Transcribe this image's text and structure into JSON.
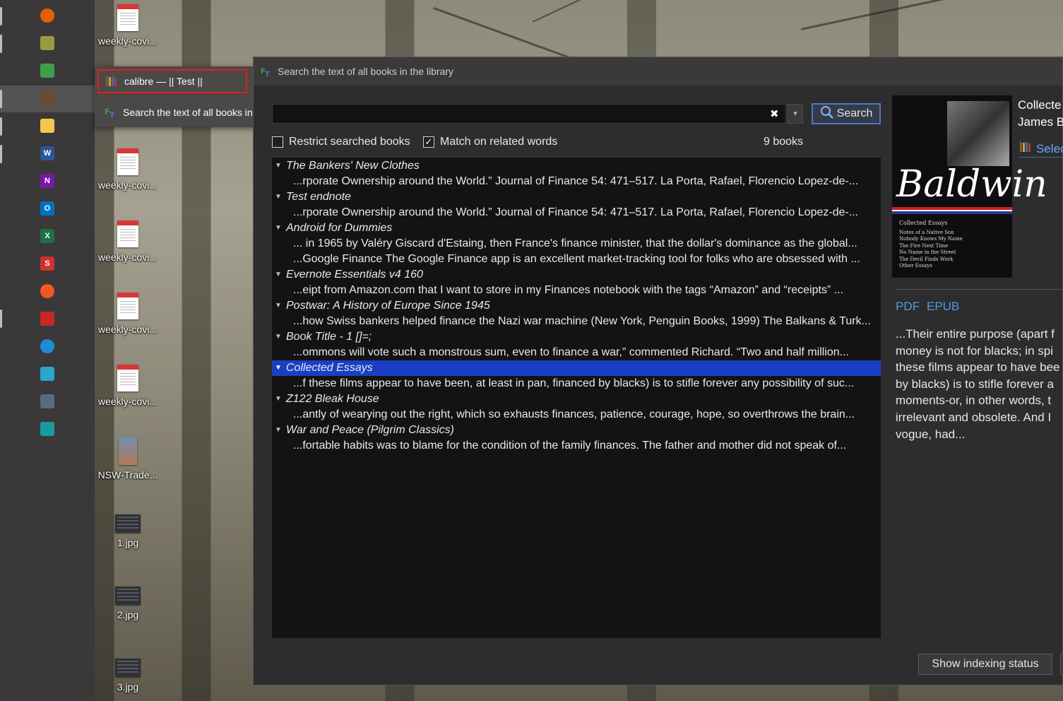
{
  "desktop": {
    "icons": [
      {
        "label": "weekly-covi...",
        "kind": "doc"
      },
      {
        "label": "weekly-covi...",
        "kind": "doc"
      },
      {
        "label": "weekly-covi...",
        "kind": "doc"
      },
      {
        "label": "weekly-covi...",
        "kind": "doc"
      },
      {
        "label": "weekly-covi...",
        "kind": "doc"
      },
      {
        "label": "NSW-Trade...",
        "kind": "book"
      },
      {
        "label": "1.jpg",
        "kind": "img"
      },
      {
        "label": "2.jpg",
        "kind": "img"
      },
      {
        "label": "3.jpg",
        "kind": "img"
      }
    ]
  },
  "taskbar": {
    "icons": [
      {
        "name": "firefox-icon",
        "color": "#e66000"
      },
      {
        "name": "money-app-icon",
        "color": "#9c9a3c"
      },
      {
        "name": "chart-app-icon",
        "color": "#3ea04a"
      },
      {
        "name": "calibre-icon",
        "color": "#6b4a2f"
      },
      {
        "name": "file-explorer-icon",
        "color": "#f2c94c"
      },
      {
        "name": "word-icon",
        "color": "#2b5797"
      },
      {
        "name": "onenote-icon",
        "color": "#7719aa"
      },
      {
        "name": "outlook-icon",
        "color": "#0072c6"
      },
      {
        "name": "excel-icon",
        "color": "#1e7145"
      },
      {
        "name": "app-s-icon",
        "color": "#d32f2f"
      },
      {
        "name": "app-refresh-icon",
        "color": "#f05a22"
      },
      {
        "name": "app-puzzle-icon",
        "color": "#c62828"
      },
      {
        "name": "edge-icon",
        "color": "#1f8dd6"
      },
      {
        "name": "app-window-icon",
        "color": "#2aa6c9"
      },
      {
        "name": "calculator-icon",
        "color": "#5b6b7b"
      },
      {
        "name": "app-search-icon",
        "color": "#1a9aa0"
      }
    ]
  },
  "jumplist": {
    "item1": "calibre — || Test ||",
    "item2": "Search the text of all books in the library"
  },
  "window": {
    "title": "Search the text of all books in the library",
    "search_value": "",
    "search_button": "Search",
    "restrict_label": "Restrict searched books",
    "restrict_checked": false,
    "match_label": "Match on related words",
    "match_checked": true,
    "book_count": "9 books",
    "results": [
      {
        "title": "The Bankers' New Clothes",
        "snippets": [
          "...rporate Ownership around the World.” Journal of Finance 54: 471–517. La Porta, Rafael, Florencio Lopez-de-..."
        ]
      },
      {
        "title": "Test endnote",
        "snippets": [
          "...rporate Ownership around the World.” Journal of Finance 54: 471–517. La Porta, Rafael, Florencio Lopez-de-..."
        ]
      },
      {
        "title": "Android for Dummies",
        "snippets": [
          "... in 1965 by Valéry Giscard d'Estaing, then France's finance minister, that the dollar's dominance as the global...",
          "...Google Finance The Google Finance app is an excellent market-tracking tool for folks who are obsessed with ..."
        ]
      },
      {
        "title": "Evernote Essentials v4 160",
        "snippets": [
          "...eipt from Amazon.com that I want to store in my Finances notebook with the tags “Amazon” and “receipts” ..."
        ]
      },
      {
        "title": "Postwar: A History of Europe Since 1945",
        "snippets": [
          "...how Swiss bankers helped finance the Nazi war machine (New York, Penguin Books, 1999) The Balkans & Turk..."
        ]
      },
      {
        "title": "Book Title - 1 []=;",
        "snippets": [
          "...ommons will vote such a monstrous sum, even to finance a war,” commented Richard. “Two and half million..."
        ]
      },
      {
        "title": "Collected Essays",
        "selected": true,
        "snippets": [
          "...f these films appear to have been, at least in pan, financed by blacks) is to stifle forever any possibility of suc..."
        ]
      },
      {
        "title": "Z122 Bleak House",
        "snippets": [
          "...antly of wearying out the right, which so exhausts finances, patience, courage, hope, so overthrows the brain..."
        ]
      },
      {
        "title": "War and Peace (Pilgrim Classics)",
        "snippets": [
          "...fortable habits was to blame for the condition of the family finances. The father and mother did not speak of..."
        ]
      }
    ],
    "detail": {
      "title_line1": "Collecte",
      "title_line2": "James B",
      "select_link": "Selec",
      "formats": [
        "PDF",
        "EPUB"
      ],
      "excerpt_lines": [
        "...Their entire purpose (apart f",
        "money is not for blacks; in spi",
        "these films appear to have bee",
        "by blacks) is to stifle forever a",
        "moments-or, in other words, t",
        "irrelevant and obsolete. And I",
        "vogue, had..."
      ],
      "cover": {
        "author": "Baldwin",
        "subtitle": "Collected Essays",
        "contents": [
          "Notes of a Native Son",
          "Nobody Knows My Name",
          "The Fire Next Time",
          "No Name in the Street",
          "The Devil Finds Work",
          "Other Essays"
        ]
      }
    },
    "index_button": "Show indexing status"
  }
}
